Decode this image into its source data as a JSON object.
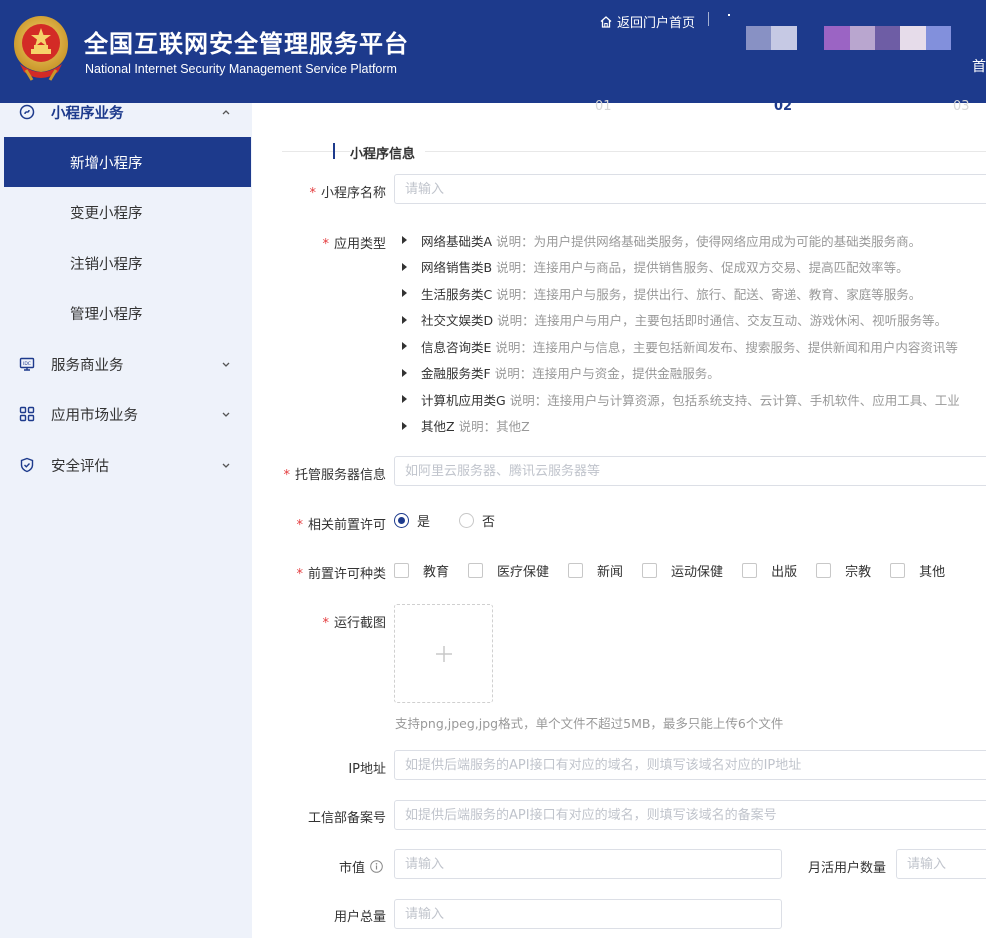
{
  "header": {
    "title_cn": "全国互联网安全管理服务平台",
    "title_en": "National Internet Security Management Service Platform",
    "portal_link": "返回门户首页",
    "home_fragment": "首"
  },
  "sidebar": {
    "groups": [
      {
        "label": "小程序业务",
        "expanded": true,
        "icon": "mini-program-icon"
      },
      {
        "label": "服务商业务",
        "expanded": false,
        "icon": "monitor-icon"
      },
      {
        "label": "应用市场业务",
        "expanded": false,
        "icon": "grid-icon"
      },
      {
        "label": "安全评估",
        "expanded": false,
        "icon": "shield-check-icon"
      }
    ],
    "sub_items": [
      {
        "label": "新增小程序",
        "active": true
      },
      {
        "label": "变更小程序",
        "active": false
      },
      {
        "label": "注销小程序",
        "active": false
      },
      {
        "label": "管理小程序",
        "active": false
      }
    ]
  },
  "steps": [
    "01",
    "02",
    "03"
  ],
  "current_step": "02",
  "form": {
    "section_title": "小程序信息",
    "name": {
      "label": "小程序名称",
      "placeholder": "请输入",
      "required": true
    },
    "app_type": {
      "label": "应用类型",
      "required": true,
      "items": [
        {
          "name": "网络基础类A",
          "desc": "说明：为用户提供网络基础类服务，使得网络应用成为可能的基础类服务商。"
        },
        {
          "name": "网络销售类B",
          "desc": "说明：连接用户与商品，提供销售服务、促成双方交易、提高匹配效率等。"
        },
        {
          "name": "生活服务类C",
          "desc": "说明：连接用户与服务，提供出行、旅行、配送、寄递、教育、家庭等服务。"
        },
        {
          "name": "社交文娱类D",
          "desc": "说明：连接用户与用户，主要包括即时通信、交友互动、游戏休闲、视听服务等。"
        },
        {
          "name": "信息咨询类E",
          "desc": "说明：连接用户与信息，主要包括新闻发布、搜索服务、提供新闻和用户内容资讯等"
        },
        {
          "name": "金融服务类F",
          "desc": "说明：连接用户与资金，提供金融服务。"
        },
        {
          "name": "计算机应用类G",
          "desc": "说明：连接用户与计算资源，包括系统支持、云计算、手机软件、应用工具、工业"
        },
        {
          "name": "其他Z",
          "desc": "说明：其他Z"
        }
      ]
    },
    "hosting": {
      "label": "托管服务器信息",
      "placeholder": "如阿里云服务器、腾讯云服务器等",
      "required": true
    },
    "pre_permit": {
      "label": "相关前置许可",
      "required": true,
      "options": [
        "是",
        "否"
      ],
      "selected": "是"
    },
    "permit_types": {
      "label": "前置许可种类",
      "required": true,
      "options": [
        "教育",
        "医疗保健",
        "新闻",
        "运动保健",
        "出版",
        "宗教",
        "其他"
      ]
    },
    "screenshot": {
      "label": "运行截图",
      "required": true,
      "hint": "支持png,jpeg,jpg格式，单个文件不超过5MB，最多只能上传6个文件"
    },
    "ip": {
      "label": "IP地址",
      "placeholder": "如提供后端服务的API接口有对应的域名，则填写该域名对应的IP地址"
    },
    "miit": {
      "label": "工信部备案号",
      "placeholder": "如提供后端服务的API接口有对应的域名，则填写该域名的备案号"
    },
    "market_value": {
      "label": "市值",
      "placeholder": "请输入"
    },
    "mau": {
      "label": "月活用户数量",
      "placeholder": "请输入"
    },
    "total_users": {
      "label": "用户总量",
      "placeholder": "请输入"
    }
  },
  "colors": {
    "brand": "#1d3a8c",
    "required": "#e4393c",
    "sidebar_bg": "#eef2fa"
  }
}
